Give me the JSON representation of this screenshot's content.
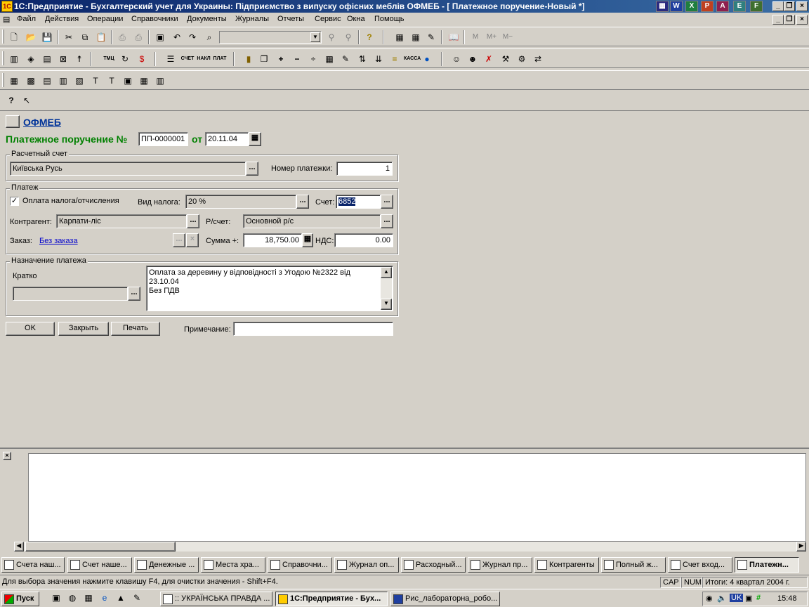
{
  "window": {
    "title": "1С:Предприятие - Бухгалтерский учет для Украины: Підприємство з випуску офісних меблів ОФМЕБ - [ Платежное поручение-Новый *]"
  },
  "menu": [
    "Файл",
    "Действия",
    "Операции",
    "Справочники",
    "Документы",
    "Журналы",
    "Отчеты",
    "Сервис",
    "Окна",
    "Помощь"
  ],
  "toolbar": {
    "mem_buttons": [
      "M",
      "M+",
      "M−"
    ],
    "toolbar2_labels": [
      "ТМЦ",
      "СЧЕТ",
      "НАКЛ",
      "ПЛАТ",
      "КАССА"
    ]
  },
  "form": {
    "org_link": "ОФМЕБ",
    "heading": "Платежное поручение №",
    "doc_number": "ПП-0000001",
    "date_prefix": "от",
    "date": "20.11.04",
    "account_group": {
      "legend": "Расчетный счет",
      "bank_value": "Київська Русь",
      "payment_no_label": "Номер платежки:",
      "payment_no": "1"
    },
    "payment_group": {
      "legend": "Платеж",
      "tax_checkbox_label": "Оплата налога/отчисления",
      "tax_checked": true,
      "tax_type_label": "Вид налога:",
      "tax_type_value": "20 %",
      "account_label": "Счет:",
      "account_value": "6852",
      "counterparty_label": "Контрагент:",
      "counterparty_value": "Карпати-ліс",
      "rs_label": "Р/счет:",
      "rs_value": "Основной р/с",
      "order_label": "Заказ:",
      "order_value": "Без заказа",
      "sum_label": "Сумма +:",
      "sum_value": "18,750.00",
      "vat_label": "НДС:",
      "vat_value": "0.00"
    },
    "purpose_group": {
      "legend": "Назначение платежа",
      "brief_label": "Кратко",
      "brief_value": "",
      "purpose_line1": "Оплата за деревину у відповідності з Угодою №2322 від 23.10.04",
      "purpose_line2": "Без ПДВ"
    },
    "buttons": {
      "ok": "OK",
      "close": "Закрыть",
      "print": "Печать"
    },
    "note_label": "Примечание:",
    "note_value": ""
  },
  "window_tabs": [
    "Счета наш...",
    "Счет наше...",
    "Денежные ...",
    "Места хра...",
    "Справочни...",
    "Журнал оп...",
    "Расходный...",
    "Журнал пр...",
    "Контрагенты",
    "Полный ж...",
    "Счет вход...",
    "Платежн..."
  ],
  "status": {
    "hint": "Для выбора значения нажмите клавишу F4, для очистки значения - Shift+F4.",
    "cap": "CAP",
    "num": "NUM",
    "period": "Итоги: 4 квартал 2004 г."
  },
  "taskbar": {
    "start": "Пуск",
    "items": [
      ":: УКРАЇНСЬКА ПРАВДА ...",
      "1С:Предприятие - Бух...",
      "Рис_лабораторна_робо..."
    ],
    "lang": "UK",
    "clock": "15:48"
  }
}
